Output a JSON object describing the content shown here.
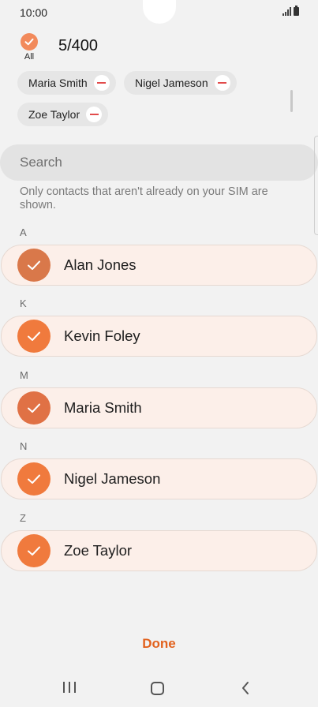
{
  "status_bar": {
    "time": "10:00"
  },
  "header": {
    "all_label": "All",
    "count": "5/400"
  },
  "selected_chips": [
    {
      "name": "Maria Smith"
    },
    {
      "name": "Nigel Jameson"
    },
    {
      "name": "Zoe Taylor"
    }
  ],
  "search": {
    "placeholder": "Search",
    "value": ""
  },
  "info_text": "Only contacts that aren't already on your SIM are shown.",
  "sections": [
    {
      "letter": "A",
      "contact": {
        "name": "Alan Jones",
        "checked": true
      }
    },
    {
      "letter": "K",
      "contact": {
        "name": "Kevin Foley",
        "checked": true
      }
    },
    {
      "letter": "M",
      "contact": {
        "name": "Maria Smith",
        "checked": true
      }
    },
    {
      "letter": "N",
      "contact": {
        "name": "Nigel Jameson",
        "checked": true
      }
    },
    {
      "letter": "Z",
      "contact": {
        "name": "Zoe Taylor",
        "checked": true
      }
    }
  ],
  "footer": {
    "done_label": "Done"
  },
  "colors": {
    "accent": "#f07a3d",
    "done_text": "#e2621e",
    "row_bg": "#fcefe9",
    "remove_red": "#e24b4b"
  },
  "icons": {
    "check": "checkmark-icon",
    "remove": "minus-circle-icon"
  }
}
